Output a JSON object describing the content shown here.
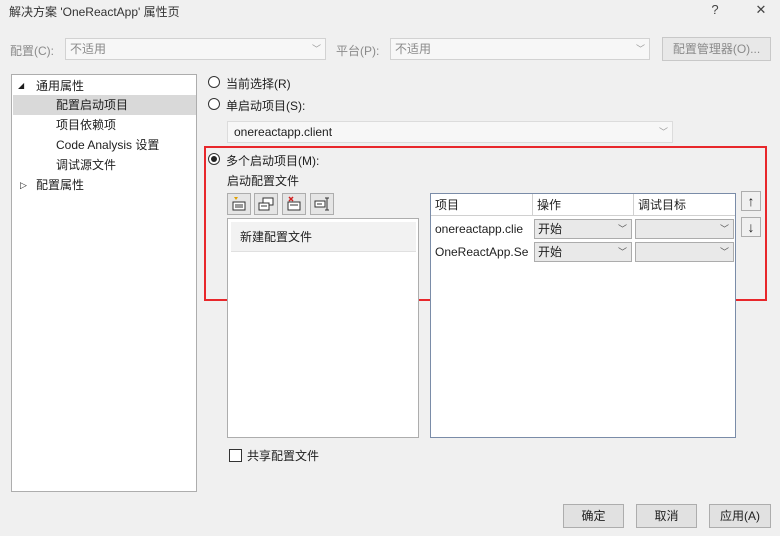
{
  "window": {
    "title": "解决方案 'OneReactApp' 属性页",
    "help": "?",
    "close": "✕"
  },
  "toolbar": {
    "config_label": "配置(C):",
    "config_value": "不适用",
    "platform_label": "平台(P):",
    "platform_value": "不适用",
    "config_manager": "配置管理器(O)..."
  },
  "tree": {
    "common": "通用属性",
    "items": [
      "配置启动项目",
      "项目依赖项",
      "Code Analysis 设置",
      "调试源文件"
    ],
    "config_props": "配置属性",
    "expanded_glyph": "◢",
    "collapsed_glyph": "▷"
  },
  "startup": {
    "current_selection": "当前选择(R)",
    "single": "单启动项目(S):",
    "single_value": "onereactapp.client",
    "multiple": "多个启动项目(M):",
    "profile_label": "启动配置文件",
    "new_profile": "新建配置文件",
    "share_profile": "共享配置文件"
  },
  "grid": {
    "headers": [
      "项目",
      "操作",
      "调试目标"
    ],
    "rows": [
      {
        "project": "onereactapp.clie",
        "action": "开始",
        "target": ""
      },
      {
        "project": "OneReactApp.Se",
        "action": "开始",
        "target": ""
      }
    ],
    "up": "↑",
    "down": "↓"
  },
  "buttons": {
    "ok": "确定",
    "cancel": "取消",
    "apply": "应用(A)"
  },
  "colors": {
    "highlight": "#e8272b",
    "selection": "#d9d9d9",
    "grid_border": "#7a8ca8"
  }
}
